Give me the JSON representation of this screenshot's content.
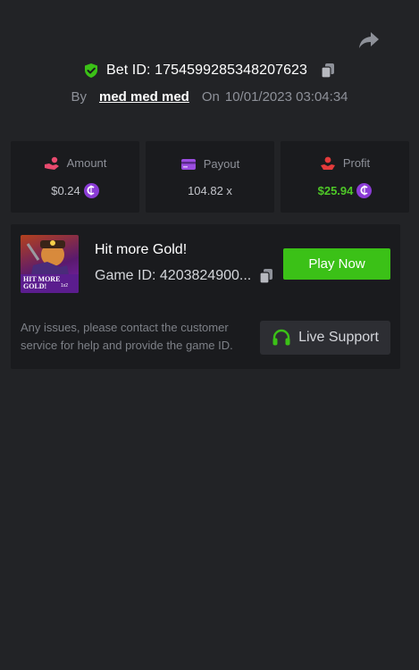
{
  "header": {
    "bet_id_label": "Bet ID: 1754599285348207623",
    "by_label": "By",
    "username": "med med med",
    "on_label": "On",
    "datetime": "10/01/2023 03:04:34"
  },
  "stats": {
    "amount": {
      "label": "Amount",
      "value": "$0.24",
      "icon": "hand-coins-icon"
    },
    "payout": {
      "label": "Payout",
      "value": "104.82 x",
      "icon": "card-icon"
    },
    "profit": {
      "label": "Profit",
      "value": "$25.94",
      "icon": "hand-money-icon"
    },
    "coin_symbol": "₵"
  },
  "game": {
    "title": "Hit more Gold!",
    "id_text": "Game ID: 4203824900...",
    "thumbnail_text": "HIT MORE GOLD!",
    "thumbnail_badge": "1x2",
    "play_label": "Play Now"
  },
  "support": {
    "help_text": "Any issues, please contact the customer service for help and provide the game ID.",
    "button_label": "Live Support"
  },
  "colors": {
    "background": "#222326",
    "card": "#1a1b1e",
    "play_green": "#3bc117",
    "profit_green": "#4ec727",
    "coin_purple": "#8b3cd6",
    "accent_pink": "#e84a6e",
    "accent_purple": "#9b4de0",
    "accent_red": "#e43b3b"
  }
}
